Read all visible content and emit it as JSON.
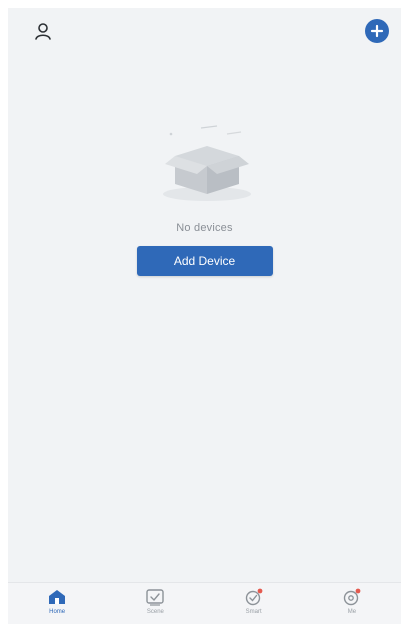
{
  "colors": {
    "accent": "#2f69b8",
    "icon_inactive": "#8c9298"
  },
  "topbar": {
    "profile_icon": "user-icon",
    "add_icon": "plus-circle-icon"
  },
  "empty_state": {
    "illustration": "empty-box-illustration",
    "message": "No devices",
    "button_label": "Add Device"
  },
  "tabs": [
    {
      "label": "Home",
      "icon": "home-icon",
      "active": true
    },
    {
      "label": "Scene",
      "icon": "scene-icon",
      "active": false
    },
    {
      "label": "Smart",
      "icon": "smart-icon",
      "active": false
    },
    {
      "label": "Me",
      "icon": "me-icon",
      "active": false
    }
  ]
}
